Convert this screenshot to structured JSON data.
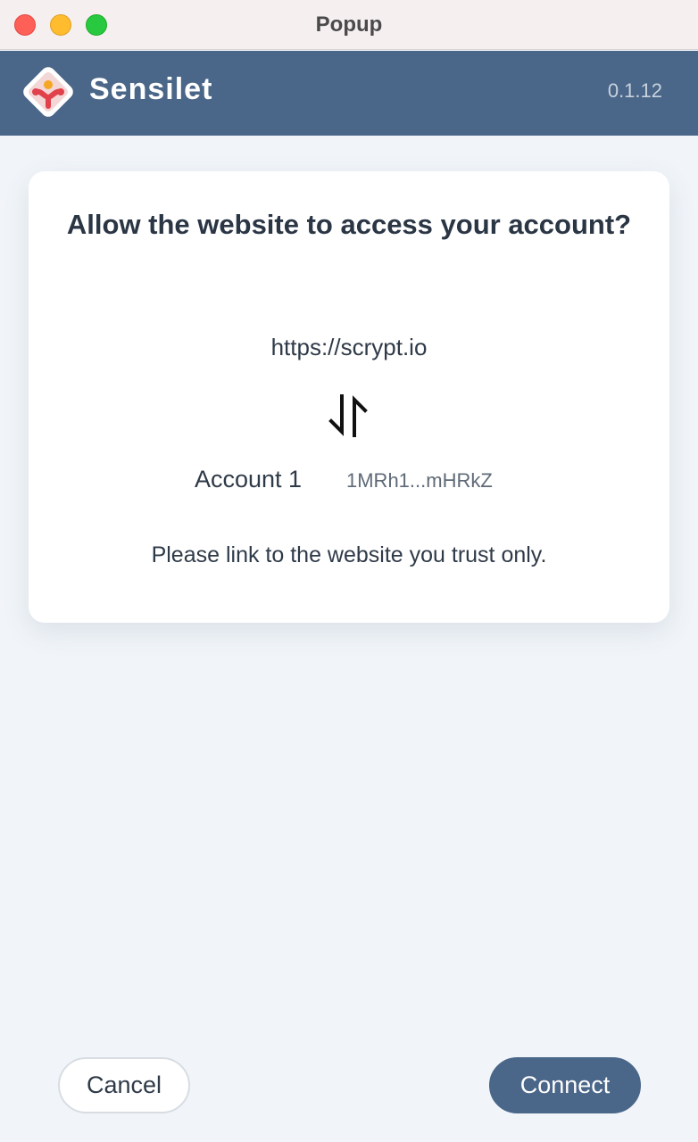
{
  "window": {
    "title": "Popup"
  },
  "header": {
    "brand": "Sensilet",
    "version": "0.1.12"
  },
  "dialog": {
    "title": "Allow the website to access your account?",
    "site_url": "https://scrypt.io",
    "swap_icon": "swap-vertical-icon",
    "account_name": "Account 1",
    "account_address": "1MRh1...mHRkZ",
    "warning": "Please link to the website you trust only."
  },
  "actions": {
    "cancel_label": "Cancel",
    "connect_label": "Connect"
  },
  "colors": {
    "header_bg": "#4a6688",
    "page_bg": "#f1f5f9",
    "connect_bg": "#4a6688"
  }
}
